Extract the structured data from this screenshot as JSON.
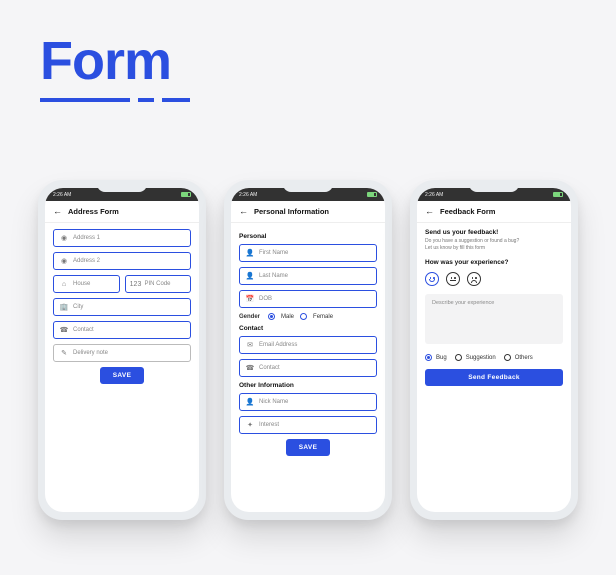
{
  "heading": "Form",
  "status": {
    "time": "2:26 AM"
  },
  "screens": {
    "address": {
      "title": "Address Form",
      "address1": "Address 1",
      "address2": "Address 2",
      "house": "House",
      "pin": "PIN Code",
      "city": "City",
      "contact": "Contact",
      "note": "Delivery note",
      "save": "SAVE"
    },
    "personal": {
      "title": "Personal Information",
      "sec_personal": "Personal",
      "first": "First Name",
      "last": "Last Name",
      "dob": "DOB",
      "gender_label": "Gender",
      "male": "Male",
      "female": "Female",
      "sec_contact": "Contact",
      "email": "Email Address",
      "contact": "Contact",
      "sec_other": "Other Information",
      "nick": "Nick Name",
      "interest": "Interest",
      "save": "SAVE"
    },
    "feedback": {
      "title": "Feedback Form",
      "head": "Send us your feedback!",
      "sub1": "Do you have a suggestion or found a bug?",
      "sub2": "Let us know by fill this form",
      "q": "How was your experience?",
      "textarea": "Describe your experience",
      "cat_bug": "Bug",
      "cat_sugg": "Suggestion",
      "cat_other": "Others",
      "send": "Send Feedback"
    }
  }
}
